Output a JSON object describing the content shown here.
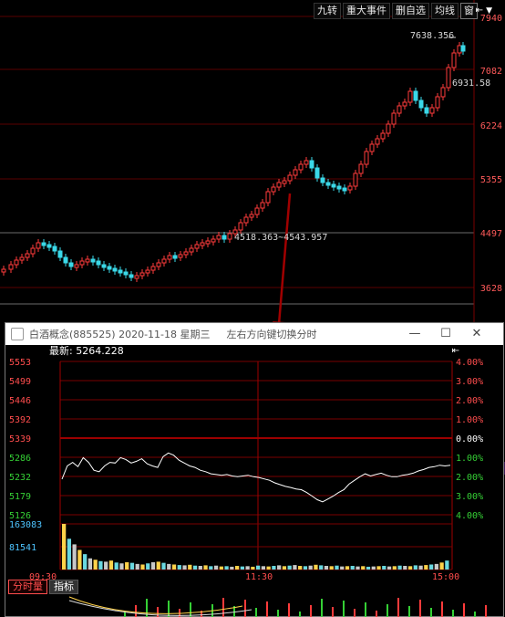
{
  "toolbar": {
    "buttons": [
      "九转",
      "重大事件",
      "删自选",
      "均线",
      "窗"
    ],
    "arrow_icon": "collapse-left-icon",
    "dropdown_icon": "triangle-down-icon"
  },
  "main_chart": {
    "price_labels": [
      "7940",
      "7082",
      "6224",
      "5355",
      "4497",
      "3628"
    ],
    "annotation_high": "7638.356",
    "annotation_right": "6931.58",
    "annotation_range": "4518.363~4543.957",
    "hidden_labels": [
      "5",
      "5",
      "9",
      "3"
    ]
  },
  "popup": {
    "title": "白酒概念(885525) 2020-11-18 星期三",
    "hint": "左右方向键切换分时",
    "window_buttons": {
      "minimize": "—",
      "maximize": "☐",
      "close": "✕"
    },
    "latest_label": "最新: 5264.228",
    "info_arrow": "collapse-left-icon",
    "tabs": [
      "分时量",
      "指标"
    ]
  },
  "chart_data": [
    {
      "type": "line",
      "title": "",
      "x_labels": [
        "09:30",
        "11:30",
        "15:00"
      ],
      "y_left": [
        "5553",
        "5499",
        "5446",
        "5392",
        "5339",
        "5286",
        "5232",
        "5179",
        "5126"
      ],
      "y_right": [
        "4.00%",
        "3.00%",
        "2.00%",
        "1.00%",
        "0.00%",
        "1.00%",
        "2.00%",
        "3.00%",
        "4.00%"
      ],
      "prev_close": 5339,
      "ylim": [
        5126,
        5553
      ],
      "series": [
        {
          "values": [
            5225,
            5262,
            5272,
            5260,
            5285,
            5272,
            5250,
            5246,
            5262,
            5272,
            5270,
            5285,
            5280,
            5270,
            5275,
            5282,
            5268,
            5262,
            5258,
            5288,
            5298,
            5292,
            5278,
            5270,
            5262,
            5258,
            5250,
            5246,
            5240,
            5238,
            5236,
            5238,
            5234,
            5232,
            5234,
            5236,
            5232,
            5230,
            5226,
            5222,
            5215,
            5210,
            5205,
            5202,
            5198,
            5196,
            5188,
            5178,
            5168,
            5162,
            5170,
            5178,
            5188,
            5196,
            5212,
            5222,
            5232,
            5240,
            5234,
            5238,
            5242,
            5236,
            5232,
            5232,
            5236,
            5238,
            5242,
            5248,
            5252,
            5258,
            5260,
            5264,
            5262,
            5264
          ]
        }
      ],
      "volume_labels": [
        "163083",
        "81541"
      ],
      "volume": [
        163083,
        110000,
        90000,
        70000,
        55000,
        40000,
        35000,
        30000,
        28000,
        32000,
        25000,
        22000,
        26000,
        24000,
        20000,
        18000,
        22000,
        26000,
        28000,
        24000,
        20000,
        18000,
        16000,
        15000,
        17000,
        14000,
        13000,
        15000,
        12000,
        14000,
        11000,
        12000,
        10000,
        13000,
        11000,
        12000,
        10000,
        14000,
        12000,
        11000,
        13000,
        15000,
        12000,
        14000,
        16000,
        13000,
        12000,
        14000,
        17000,
        15000,
        13000,
        12000,
        14000,
        11000,
        12000,
        13000,
        11000,
        12000,
        10000,
        11000,
        12000,
        13000,
        11000,
        12000,
        14000,
        13000,
        12000,
        15000,
        14000,
        16000,
        18000,
        20000,
        25000,
        32000
      ]
    }
  ]
}
